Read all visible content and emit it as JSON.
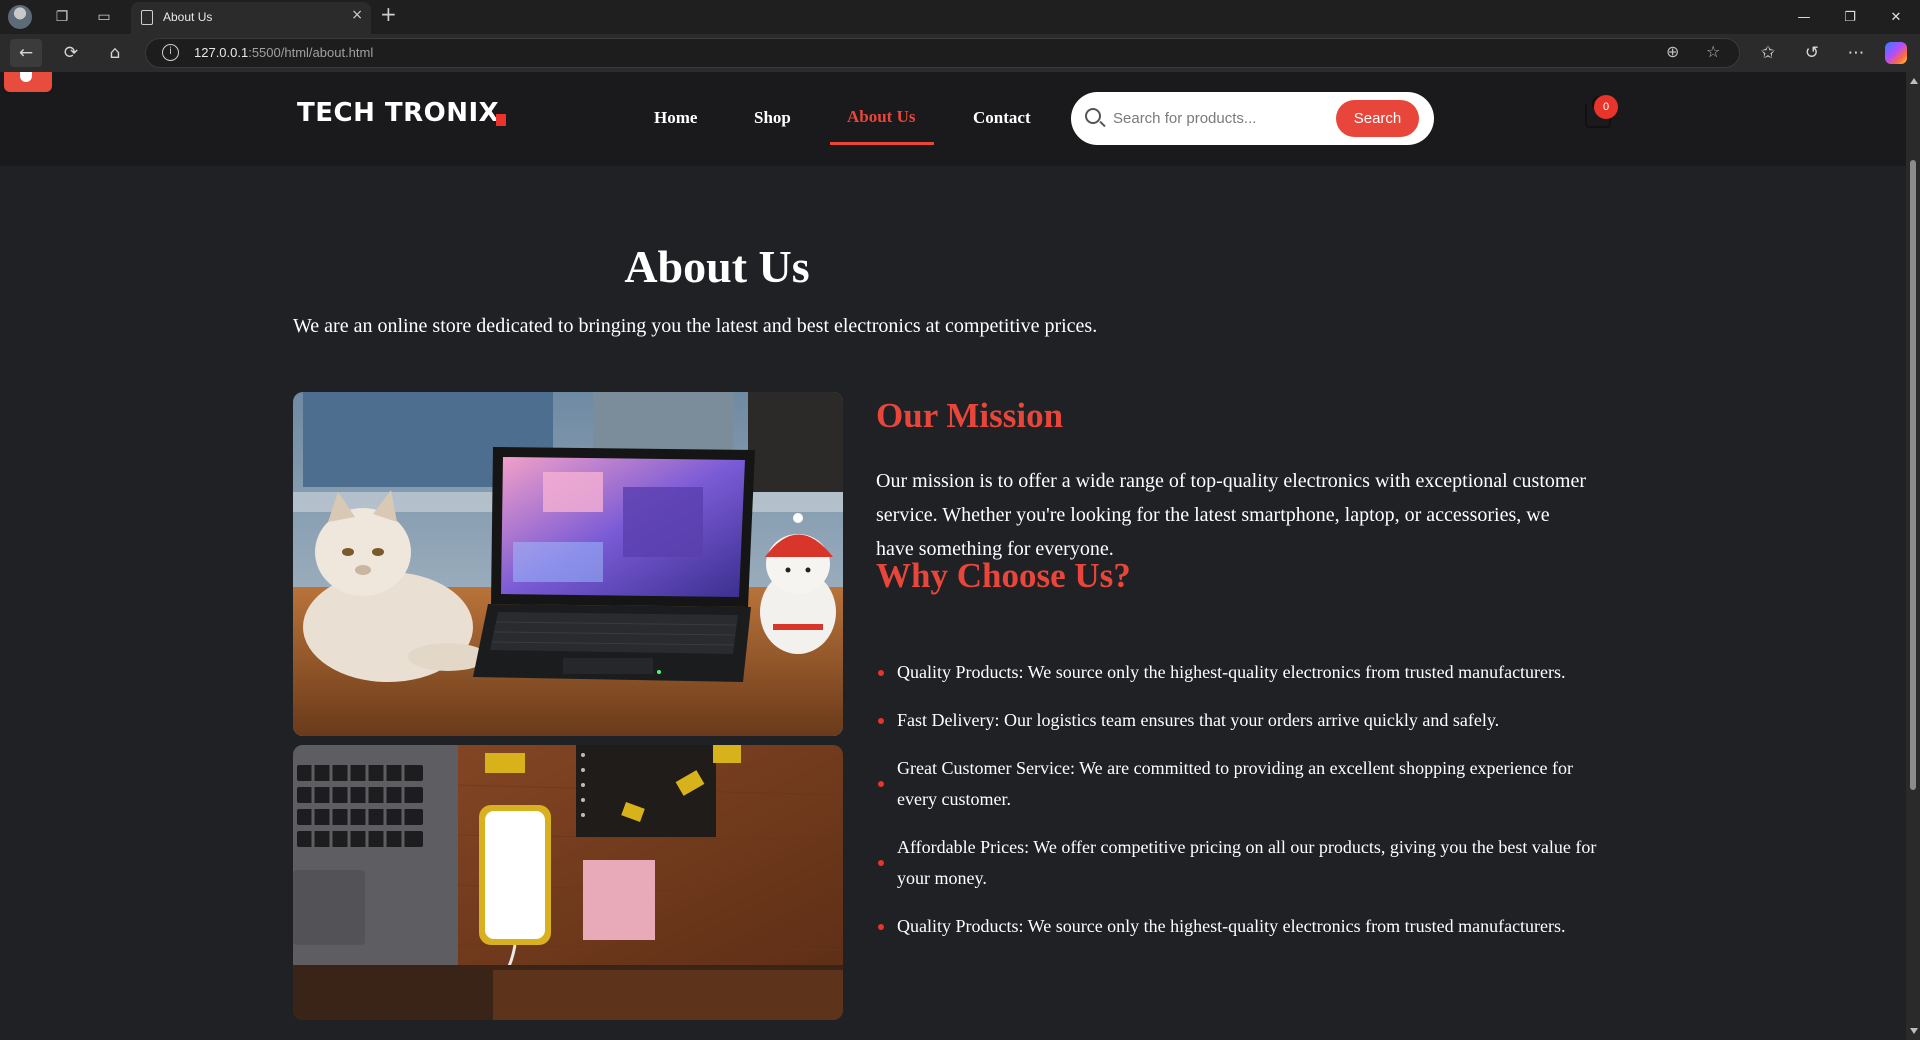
{
  "browser": {
    "tab_title": "About Us",
    "tab_close": "×",
    "new_tab": "+",
    "url_host": "127.0.0.1",
    "url_rest": ":5500/html/about.html",
    "icons": {
      "back": "←",
      "refresh": "⟳",
      "home": "⌂",
      "info": "i",
      "zoom": "⊕",
      "favorite": "☆",
      "favorites_bar": "✩",
      "history": "↺",
      "more": "⋯",
      "workspaces": "❐",
      "tab_actions": "▭",
      "minimize": "—",
      "restore": "❐",
      "close": "✕"
    }
  },
  "header": {
    "logo": "TECH TRONIX",
    "nav": [
      {
        "label": "Home",
        "active": false
      },
      {
        "label": "Shop",
        "active": false
      },
      {
        "label": "About Us",
        "active": true
      },
      {
        "label": "Contact",
        "active": false
      }
    ],
    "search": {
      "placeholder": "Search for products...",
      "button": "Search"
    },
    "cart_count": "0"
  },
  "content": {
    "title": "About Us",
    "intro": "We are an online store dedicated to bringing you the latest and best electronics at competitive prices.",
    "mission_heading": "Our Mission",
    "mission_text": "Our mission is to offer a wide range of top-quality electronics with exceptional customer service. Whether you're looking for the latest smartphone, laptop, or accessories, we have something for everyone.",
    "why_heading": "Why Choose Us?",
    "reasons": [
      "Quality Products: We source only the highest-quality electronics from trusted manufacturers.",
      "Fast Delivery: Our logistics team ensures that your orders arrive quickly and safely.",
      "Great Customer Service: We are committed to providing an excellent shopping experience for every customer.",
      "Affordable Prices: We offer competitive pricing on all our products, giving you the best value for your money.",
      "Quality Products: We source only the highest-quality electronics from trusted manufacturers."
    ]
  },
  "colors": {
    "accent": "#e8463a",
    "page_bg": "#202124",
    "header_bg": "#1a1a1c"
  }
}
